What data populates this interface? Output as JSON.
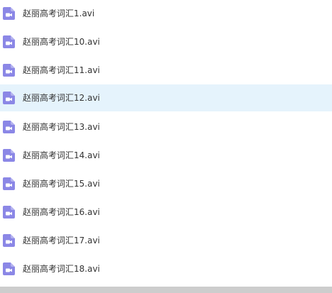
{
  "files": [
    {
      "name": "赵丽高考词汇1.avi",
      "icon": "video-file-icon",
      "selected": false
    },
    {
      "name": "赵丽高考词汇10.avi",
      "icon": "video-file-icon",
      "selected": false
    },
    {
      "name": "赵丽高考词汇11.avi",
      "icon": "video-file-icon",
      "selected": false
    },
    {
      "name": "赵丽高考词汇12.avi",
      "icon": "video-file-icon",
      "selected": true
    },
    {
      "name": "赵丽高考词汇13.avi",
      "icon": "video-file-icon",
      "selected": false
    },
    {
      "name": "赵丽高考词汇14.avi",
      "icon": "video-file-icon",
      "selected": false
    },
    {
      "name": "赵丽高考词汇15.avi",
      "icon": "video-file-icon",
      "selected": false
    },
    {
      "name": "赵丽高考词汇16.avi",
      "icon": "video-file-icon",
      "selected": false
    },
    {
      "name": "赵丽高考词汇17.avi",
      "icon": "video-file-icon",
      "selected": false
    },
    {
      "name": "赵丽高考词汇18.avi",
      "icon": "video-file-icon",
      "selected": false
    }
  ],
  "colors": {
    "icon": "#8b87e6",
    "selected_row": "#e5f3fc",
    "text": "#333333"
  }
}
